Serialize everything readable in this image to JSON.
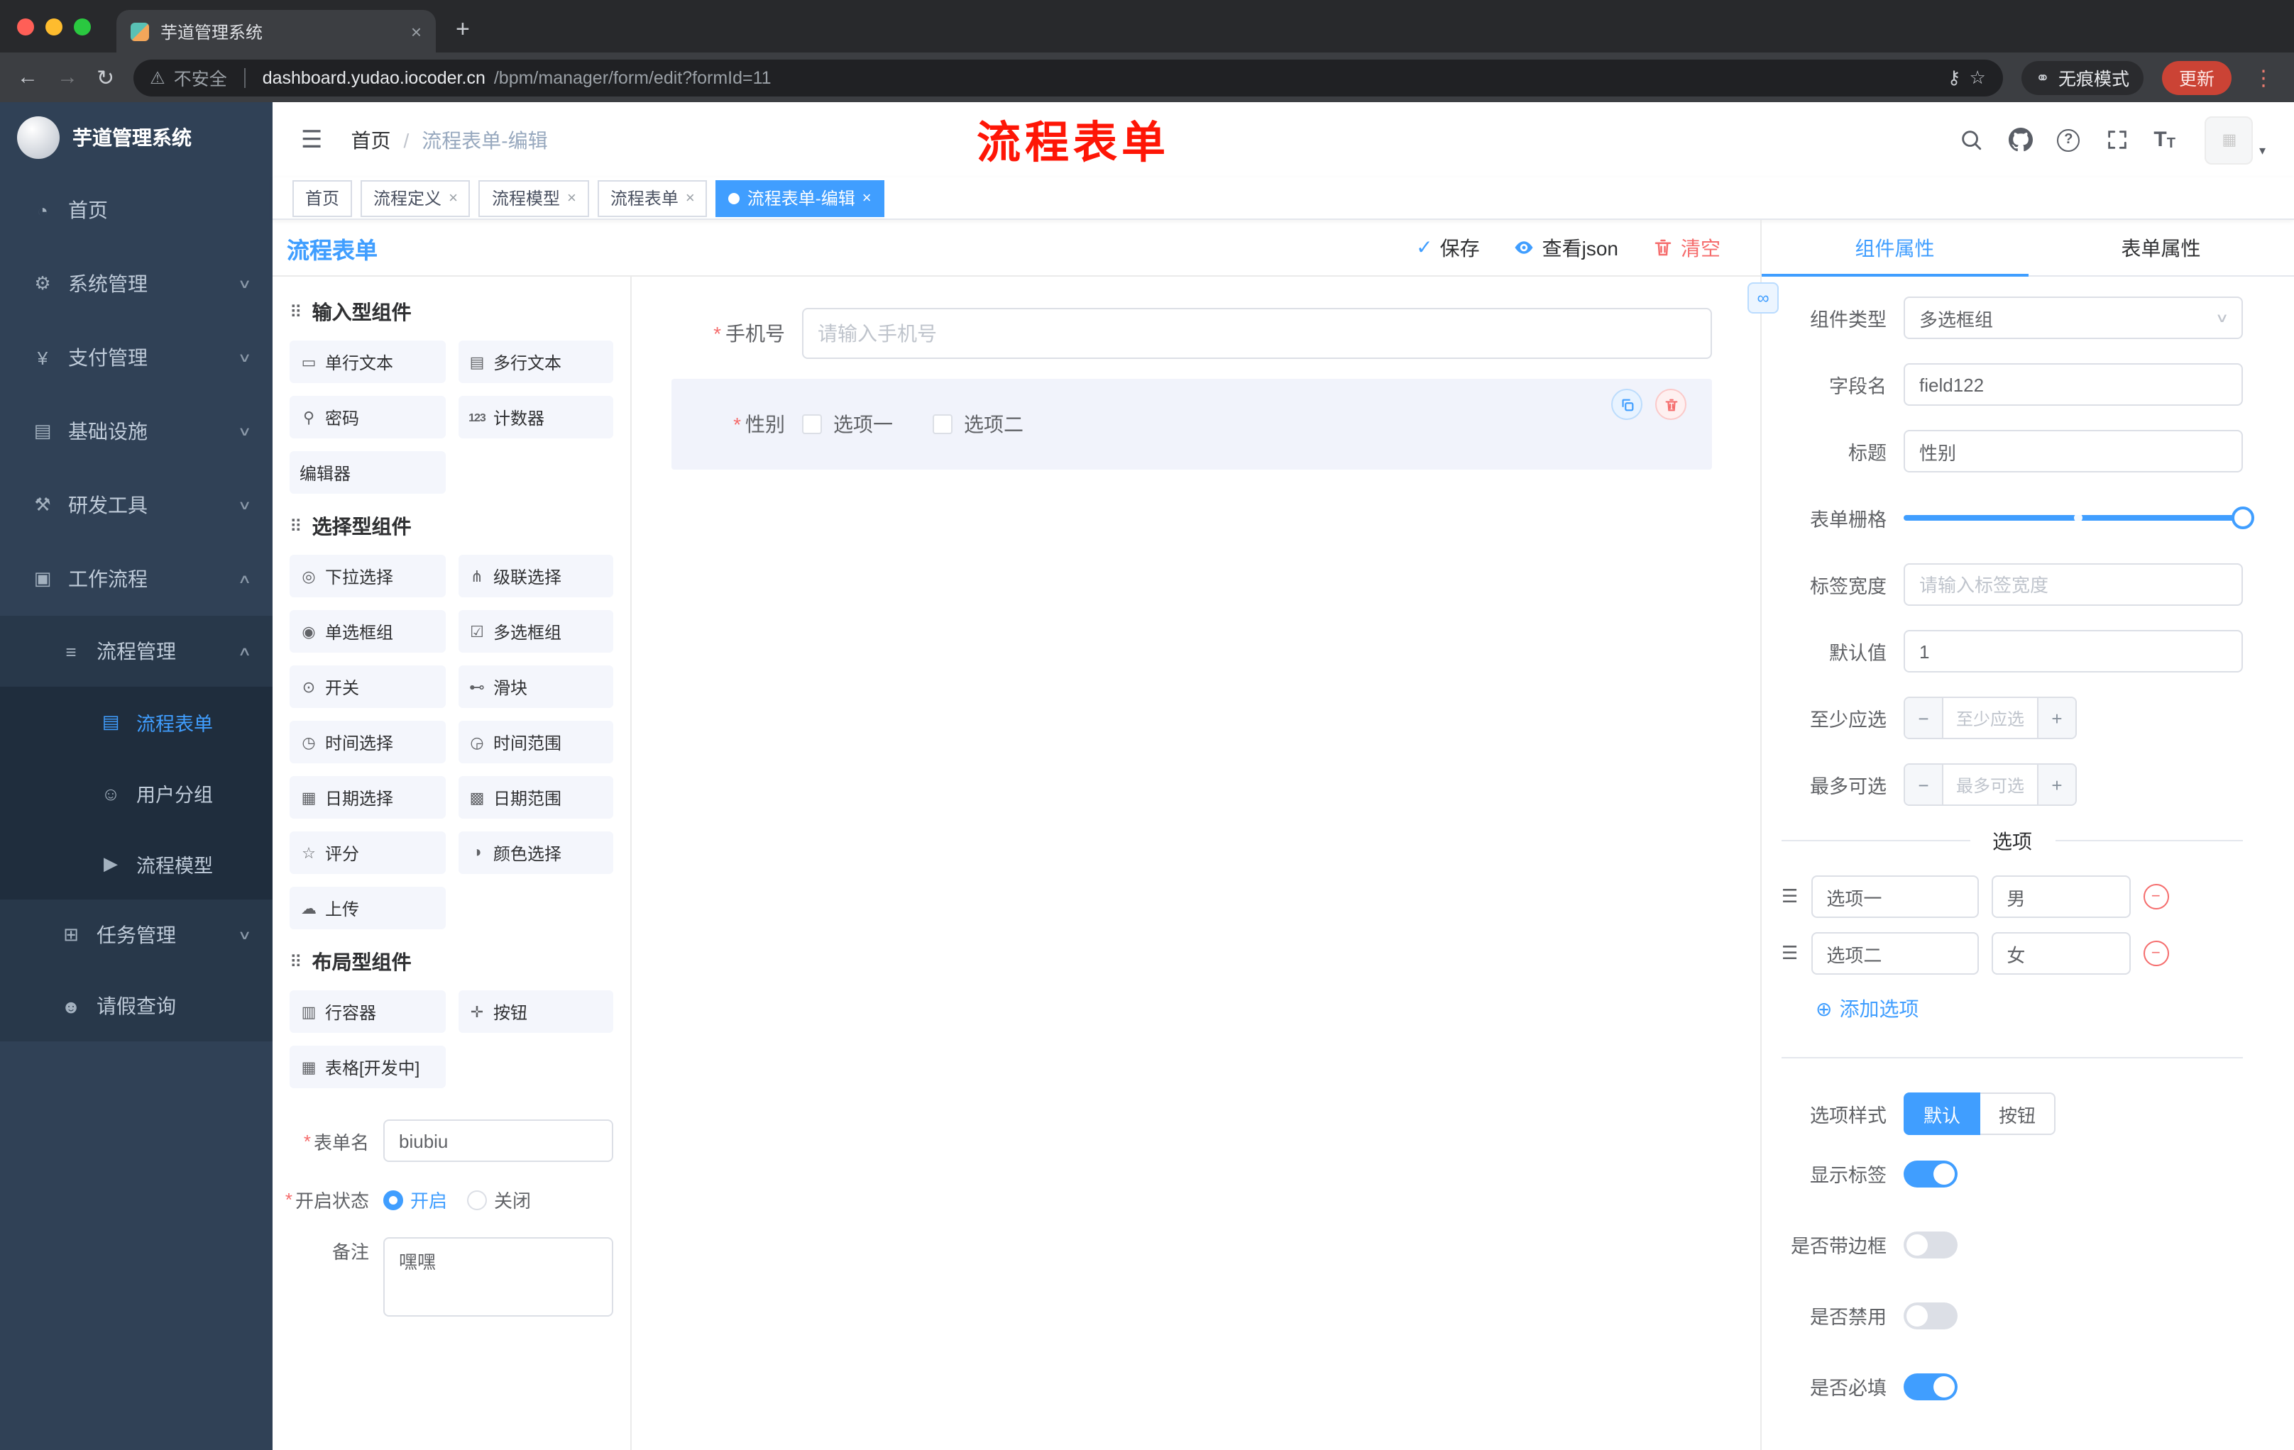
{
  "colors": {
    "accent": "#409eff",
    "danger": "#f56c6c",
    "annotation": "#fe1606",
    "sidebar_bg": "#304156"
  },
  "icons": {
    "close": "×",
    "plus": "+",
    "back": "←",
    "forward": "→",
    "reload": "↻",
    "warning": "⚠",
    "key": "⚷",
    "star": "☆",
    "kebab": "⋮",
    "incognito": "⚭",
    "hamburger": "☰",
    "chevron_down": "∨",
    "chevron_up": "∧",
    "breadcrumb_sep": "/",
    "question": "?",
    "font_big": "T",
    "font_small": "T",
    "check": "✓",
    "caret": "▾",
    "image": "▦",
    "section_drag": "⠿",
    "option_drag": "☰",
    "add": "⊕",
    "minus": "−",
    "asterisk": "*",
    "link": "∞",
    "select_arrow": "∨"
  },
  "browser": {
    "tab_title": "芋道管理系统",
    "security": "不安全",
    "url_host": "dashboard.yudao.iocoder.cn",
    "url_path": "/bpm/manager/form/edit?formId=11",
    "incognito": "无痕模式",
    "update": "更新"
  },
  "sidebar": {
    "title": "芋道管理系统",
    "menu": [
      {
        "label": "首页",
        "icon": "◔"
      },
      {
        "label": "系统管理",
        "icon": "⚙"
      },
      {
        "label": "支付管理",
        "icon": "¥"
      },
      {
        "label": "基础设施",
        "icon": "▤"
      },
      {
        "label": "研发工具",
        "icon": "⚒"
      },
      {
        "label": "工作流程",
        "icon": "▣"
      }
    ],
    "workflow": {
      "process": {
        "label": "流程管理",
        "icon": "≡",
        "children": [
          {
            "label": "流程表单",
            "icon": "▤"
          },
          {
            "label": "用户分组",
            "icon": "☺"
          },
          {
            "label": "流程模型",
            "icon": "▶"
          }
        ]
      },
      "task": {
        "label": "任务管理",
        "icon": "⊞"
      },
      "leave": {
        "label": "请假查询",
        "icon": "☻"
      }
    }
  },
  "navbar": {
    "breadcrumb_home": "首页",
    "breadcrumb_current": "流程表单-编辑"
  },
  "annotation": "流程表单",
  "tags": [
    {
      "label": "首页"
    },
    {
      "label": "流程定义"
    },
    {
      "label": "流程模型"
    },
    {
      "label": "流程表单"
    },
    {
      "label": "流程表单-编辑"
    }
  ],
  "editor": {
    "title": "流程表单",
    "save": "保存",
    "view_json": "查看json",
    "clear": "清空"
  },
  "palette": {
    "sections": [
      {
        "title": "输入型组件",
        "items": [
          {
            "label": "单行文本",
            "icon": "▭"
          },
          {
            "label": "多行文本",
            "icon": "▤"
          },
          {
            "label": "密码",
            "icon": "⚲"
          },
          {
            "label": "计数器",
            "icon": "123"
          },
          {
            "label": "编辑器"
          }
        ]
      },
      {
        "title": "选择型组件",
        "items": [
          {
            "label": "下拉选择",
            "icon": "◎"
          },
          {
            "label": "级联选择",
            "icon": "⋔"
          },
          {
            "label": "单选框组",
            "icon": "◉"
          },
          {
            "label": "多选框组",
            "icon": "☑"
          },
          {
            "label": "开关",
            "icon": "⊙"
          },
          {
            "label": "滑块",
            "icon": "⊷"
          },
          {
            "label": "时间选择",
            "icon": "◷"
          },
          {
            "label": "时间范围",
            "icon": "◶"
          },
          {
            "label": "日期选择",
            "icon": "▦"
          },
          {
            "label": "日期范围",
            "icon": "▩"
          },
          {
            "label": "评分",
            "icon": "☆"
          },
          {
            "label": "颜色选择",
            "icon": "◑"
          },
          {
            "label": "上传",
            "icon": "☁"
          }
        ]
      },
      {
        "title": "布局型组件",
        "items": [
          {
            "label": "行容器",
            "icon": "▥"
          },
          {
            "label": "按钮",
            "icon": "✛"
          },
          {
            "label": "表格[开发中]",
            "icon": "▦"
          }
        ]
      }
    ],
    "form": {
      "name_label": "表单名",
      "name_value": "biubiu",
      "status_label": "开启状态",
      "status_on": "开启",
      "status_off": "关闭",
      "remark_label": "备注",
      "remark_value": "嘿嘿"
    }
  },
  "canvas": {
    "phone_label": "手机号",
    "phone_placeholder": "请输入手机号",
    "gender_label": "性别",
    "gender_opt1": "选项一",
    "gender_opt2": "选项二"
  },
  "props": {
    "tab_component": "组件属性",
    "tab_form": "表单属性",
    "type_label": "组件类型",
    "type_value": "多选框组",
    "field_label": "字段名",
    "field_value": "field122",
    "title_label": "标题",
    "title_value": "性别",
    "grid_label": "表单栅格",
    "width_label": "标签宽度",
    "width_placeholder": "请输入标签宽度",
    "default_label": "默认值",
    "default_value": "1",
    "min_label": "至少应选",
    "min_placeholder": "至少应选",
    "max_label": "最多可选",
    "max_placeholder": "最多可选",
    "options_title": "选项",
    "options": [
      {
        "name": "选项一",
        "value": "男"
      },
      {
        "name": "选项二",
        "value": "女"
      }
    ],
    "add_option": "添加选项",
    "style_label": "选项样式",
    "style_default": "默认",
    "style_button": "按钮",
    "toggle_show_label": "显示标签",
    "toggle_border": "是否带边框",
    "toggle_disabled": "是否禁用",
    "toggle_required": "是否必填"
  }
}
